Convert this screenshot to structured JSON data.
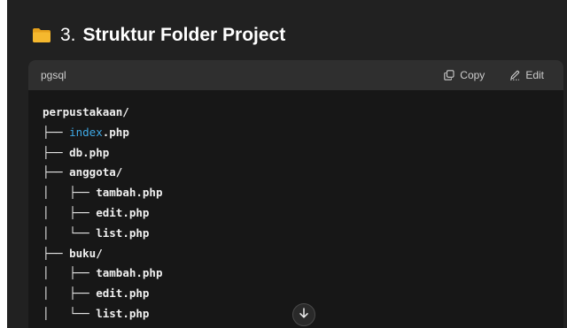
{
  "section": {
    "number": "3.",
    "title": "Struktur Folder Project",
    "icon": "folder-icon",
    "icon_color": "#f5b82e"
  },
  "code_block": {
    "language": "pgsql",
    "copy_label": "Copy",
    "edit_label": "Edit",
    "lines": [
      {
        "prefix": "",
        "highlight": "",
        "text": "perpustakaan/"
      },
      {
        "prefix": "├── ",
        "highlight": "index",
        "text": ".php"
      },
      {
        "prefix": "├── ",
        "highlight": "",
        "text": "db.php"
      },
      {
        "prefix": "├── ",
        "highlight": "",
        "text": "anggota/"
      },
      {
        "prefix": "│   ├── ",
        "highlight": "",
        "text": "tambah.php"
      },
      {
        "prefix": "│   ├── ",
        "highlight": "",
        "text": "edit.php"
      },
      {
        "prefix": "│   └── ",
        "highlight": "",
        "text": "list.php"
      },
      {
        "prefix": "├── ",
        "highlight": "",
        "text": "buku/"
      },
      {
        "prefix": "│   ├── ",
        "highlight": "",
        "text": "tambah.php"
      },
      {
        "prefix": "│   ├── ",
        "highlight": "",
        "text": "edit.php"
      },
      {
        "prefix": "│   └── ",
        "highlight": "",
        "text": "list.php"
      }
    ]
  },
  "scroll_down": {
    "icon": "arrow-down-icon"
  },
  "colors": {
    "background": "#212121",
    "code_background": "#171717",
    "code_header": "#2f2f2f",
    "keyword": "#3fa9e6"
  }
}
